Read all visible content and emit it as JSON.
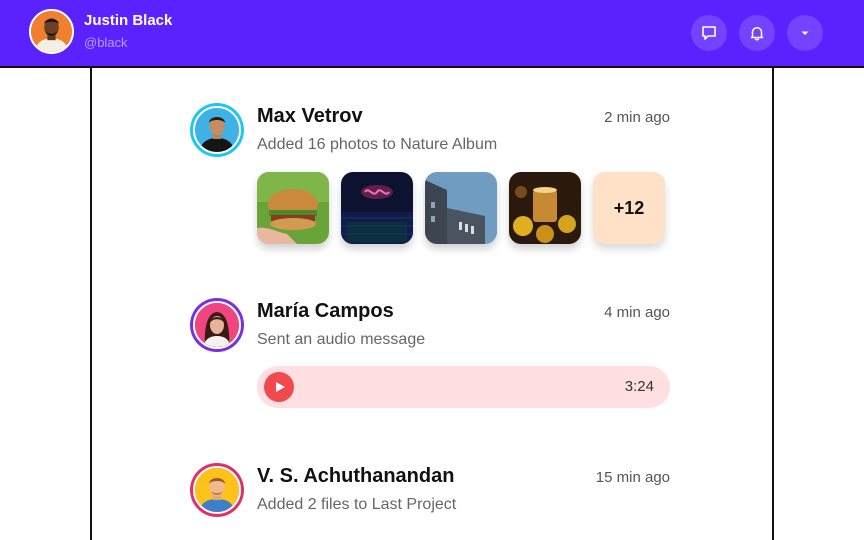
{
  "profile": {
    "name": "Justin Black",
    "handle": "@black"
  },
  "header": {
    "buttons": [
      {
        "icon": "message-icon"
      },
      {
        "icon": "bell-icon"
      },
      {
        "icon": "caret-down-icon"
      }
    ]
  },
  "colors": {
    "header_bg": "#5b22ff",
    "header_button_bg": "#7443ff",
    "audio_bg": "#ffdfe2",
    "play_button": "#f04a4f",
    "more_tile_bg": "#ffe1c7"
  },
  "feed": [
    {
      "user": "Max Vetrov",
      "time": "2 min ago",
      "activity": "Added 16 photos to Nature Album",
      "ring_color": "#1fc7f0",
      "photos": [
        "burger-photo",
        "neon-sign-photo",
        "building-photo",
        "drinks-photo"
      ],
      "more_count": "+12"
    },
    {
      "user": "María Campos",
      "time": "4 min ago",
      "activity": "Sent an audio message",
      "ring_color": "#7a2fe0",
      "audio_duration": "3:24"
    },
    {
      "user": "V. S. Achuthanandan",
      "time": "15 min ago",
      "activity": "Added 2 files to Last Project",
      "ring_color": "#e0306a"
    }
  ]
}
